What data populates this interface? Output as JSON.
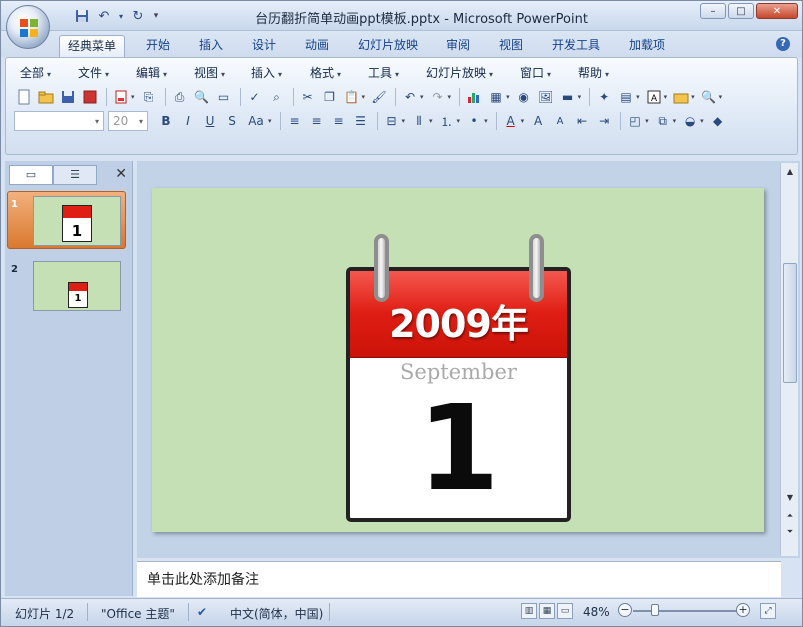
{
  "window": {
    "title": "台历翻折简单动画ppt模板.pptx - Microsoft PowerPoint",
    "minimize": "–",
    "maximize": "□",
    "close": "✕"
  },
  "ribbon_tabs": [
    "经典菜单",
    "开始",
    "插入",
    "设计",
    "动画",
    "幻灯片放映",
    "审阅",
    "视图",
    "开发工具",
    "加载项"
  ],
  "menus": [
    "全部",
    "文件",
    "编辑",
    "视图",
    "插入",
    "格式",
    "工具",
    "幻灯片放映",
    "窗口",
    "帮助"
  ],
  "font_size": "20",
  "thumbnails": [
    {
      "number": "1",
      "selected": true
    },
    {
      "number": "2",
      "selected": false
    }
  ],
  "slide": {
    "year": "2009年",
    "month": "September",
    "day": "1"
  },
  "notes_placeholder": "单击此处添加备注",
  "status": {
    "slide_indicator": "幻灯片 1/2",
    "theme": "\"Office 主题\"",
    "language": "中文(简体，中国)",
    "zoom": "48%"
  }
}
